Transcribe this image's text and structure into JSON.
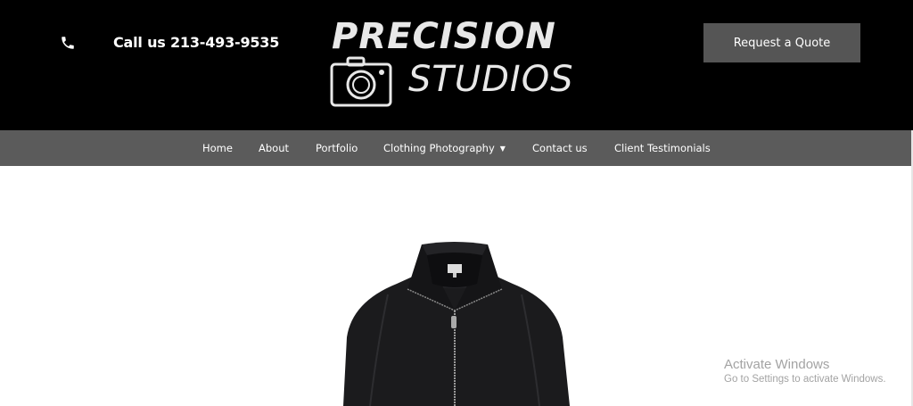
{
  "header": {
    "call_text": "Call us 213-493-9535",
    "logo_line1": "PRECISION",
    "logo_line2": "STUDIOS",
    "quote_button": "Request a Quote"
  },
  "nav": {
    "items": [
      {
        "label": "Home"
      },
      {
        "label": "About"
      },
      {
        "label": "Portfolio"
      },
      {
        "label": "Clothing Photography",
        "has_dropdown": true
      },
      {
        "label": "Contact us"
      },
      {
        "label": "Client Testimonials"
      }
    ]
  },
  "watermark": {
    "title": "Activate Windows",
    "subtitle": "Go to Settings to activate Windows."
  },
  "colors": {
    "header_bg": "#000000",
    "nav_bg": "#5b5b5b",
    "button_bg": "#555555"
  }
}
